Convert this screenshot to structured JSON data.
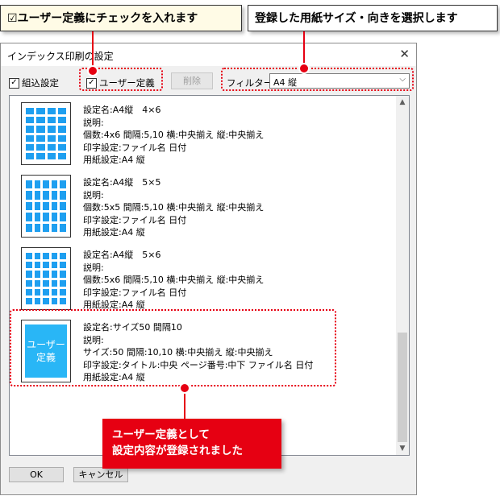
{
  "annotations": {
    "callout_left": "☑ユーザー定義にチェックを入れます",
    "callout_right": "登録した用紙サイズ・向きを選択します",
    "note_line1": "ユーザー定義として",
    "note_line2": "設定内容が登録されました",
    "accent_color": "#e60012"
  },
  "dialog": {
    "title": "インデックス印刷の設定",
    "close_glyph": "✕",
    "toolbar": {
      "builtin_label": "組込設定",
      "builtin_checked": true,
      "user_label": "ユーザー定義",
      "user_checked": true,
      "delete_label": "削除",
      "filter_label": "フィルター",
      "filter_value": "A4 縦"
    },
    "items": [
      {
        "lines": [
          "設定名:A4縦　4×6",
          "説明:",
          "個数:4x6 間隔:5,10 横:中央揃え 縦:中央揃え",
          "印字設定:ファイル名 日付",
          "用紙設定:A4 縦"
        ],
        "cols": 4,
        "rows": 6
      },
      {
        "lines": [
          "設定名:A4縦　5×5",
          "説明:",
          "個数:5x5 間隔:5,10 横:中央揃え 縦:中央揃え",
          "印字設定:ファイル名 日付",
          "用紙設定:A4 縦"
        ],
        "cols": 5,
        "rows": 5
      },
      {
        "lines": [
          "設定名:A4縦　5×6",
          "説明:",
          "個数:5x6 間隔:5,10 横:中央揃え 縦:中央揃え",
          "印字設定:ファイル名 日付",
          "用紙設定:A4 縦"
        ],
        "cols": 5,
        "rows": 6
      },
      {
        "lines": [
          "設定名:サイズ50 間隔10",
          "説明:",
          "サイズ:50 間隔:10,10 横:中央揃え 縦:中央揃え",
          "印字設定:タイトル:中央 ページ番号:中下 ファイル名 日付",
          "用紙設定:A4 縦"
        ],
        "thumb_text1": "ユーザー",
        "thumb_text2": "定義"
      }
    ],
    "ok_label": "OK",
    "cancel_label": "キャンセル"
  }
}
